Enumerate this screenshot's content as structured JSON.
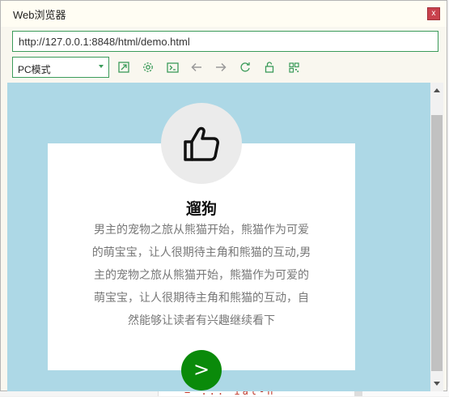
{
  "window": {
    "title": "Web浏览器",
    "close_label": "x"
  },
  "address_bar": {
    "url": "http://127.0.0.1:8848/html/demo.html"
  },
  "toolbar": {
    "mode_selected": "PC模式",
    "icons": [
      "open-external-icon",
      "settings-icon",
      "console-icon",
      "back-icon",
      "forward-icon",
      "refresh-icon",
      "lock-icon",
      "qrcode-icon"
    ]
  },
  "page": {
    "background_color": "#add8e6",
    "card": {
      "title": "遛狗",
      "text": "男主的宠物之旅从熊猫开始，熊猫作为可爱的萌宝宝，让人很期待主角和熊猫的互动,男主的宠物之旅从熊猫开始，熊猫作为可爱的萌宝宝，让人很期待主角和熊猫的互动，自然能够让读者有兴趣继续看下",
      "icon": "thumbs-up-icon",
      "button_label": ">",
      "button_color": "#0a8a0a"
    }
  },
  "background_editor": {
    "code_fragment": "= ... ial-h"
  },
  "colors": {
    "accent": "#3b9b5a",
    "close": "#c9424d"
  }
}
